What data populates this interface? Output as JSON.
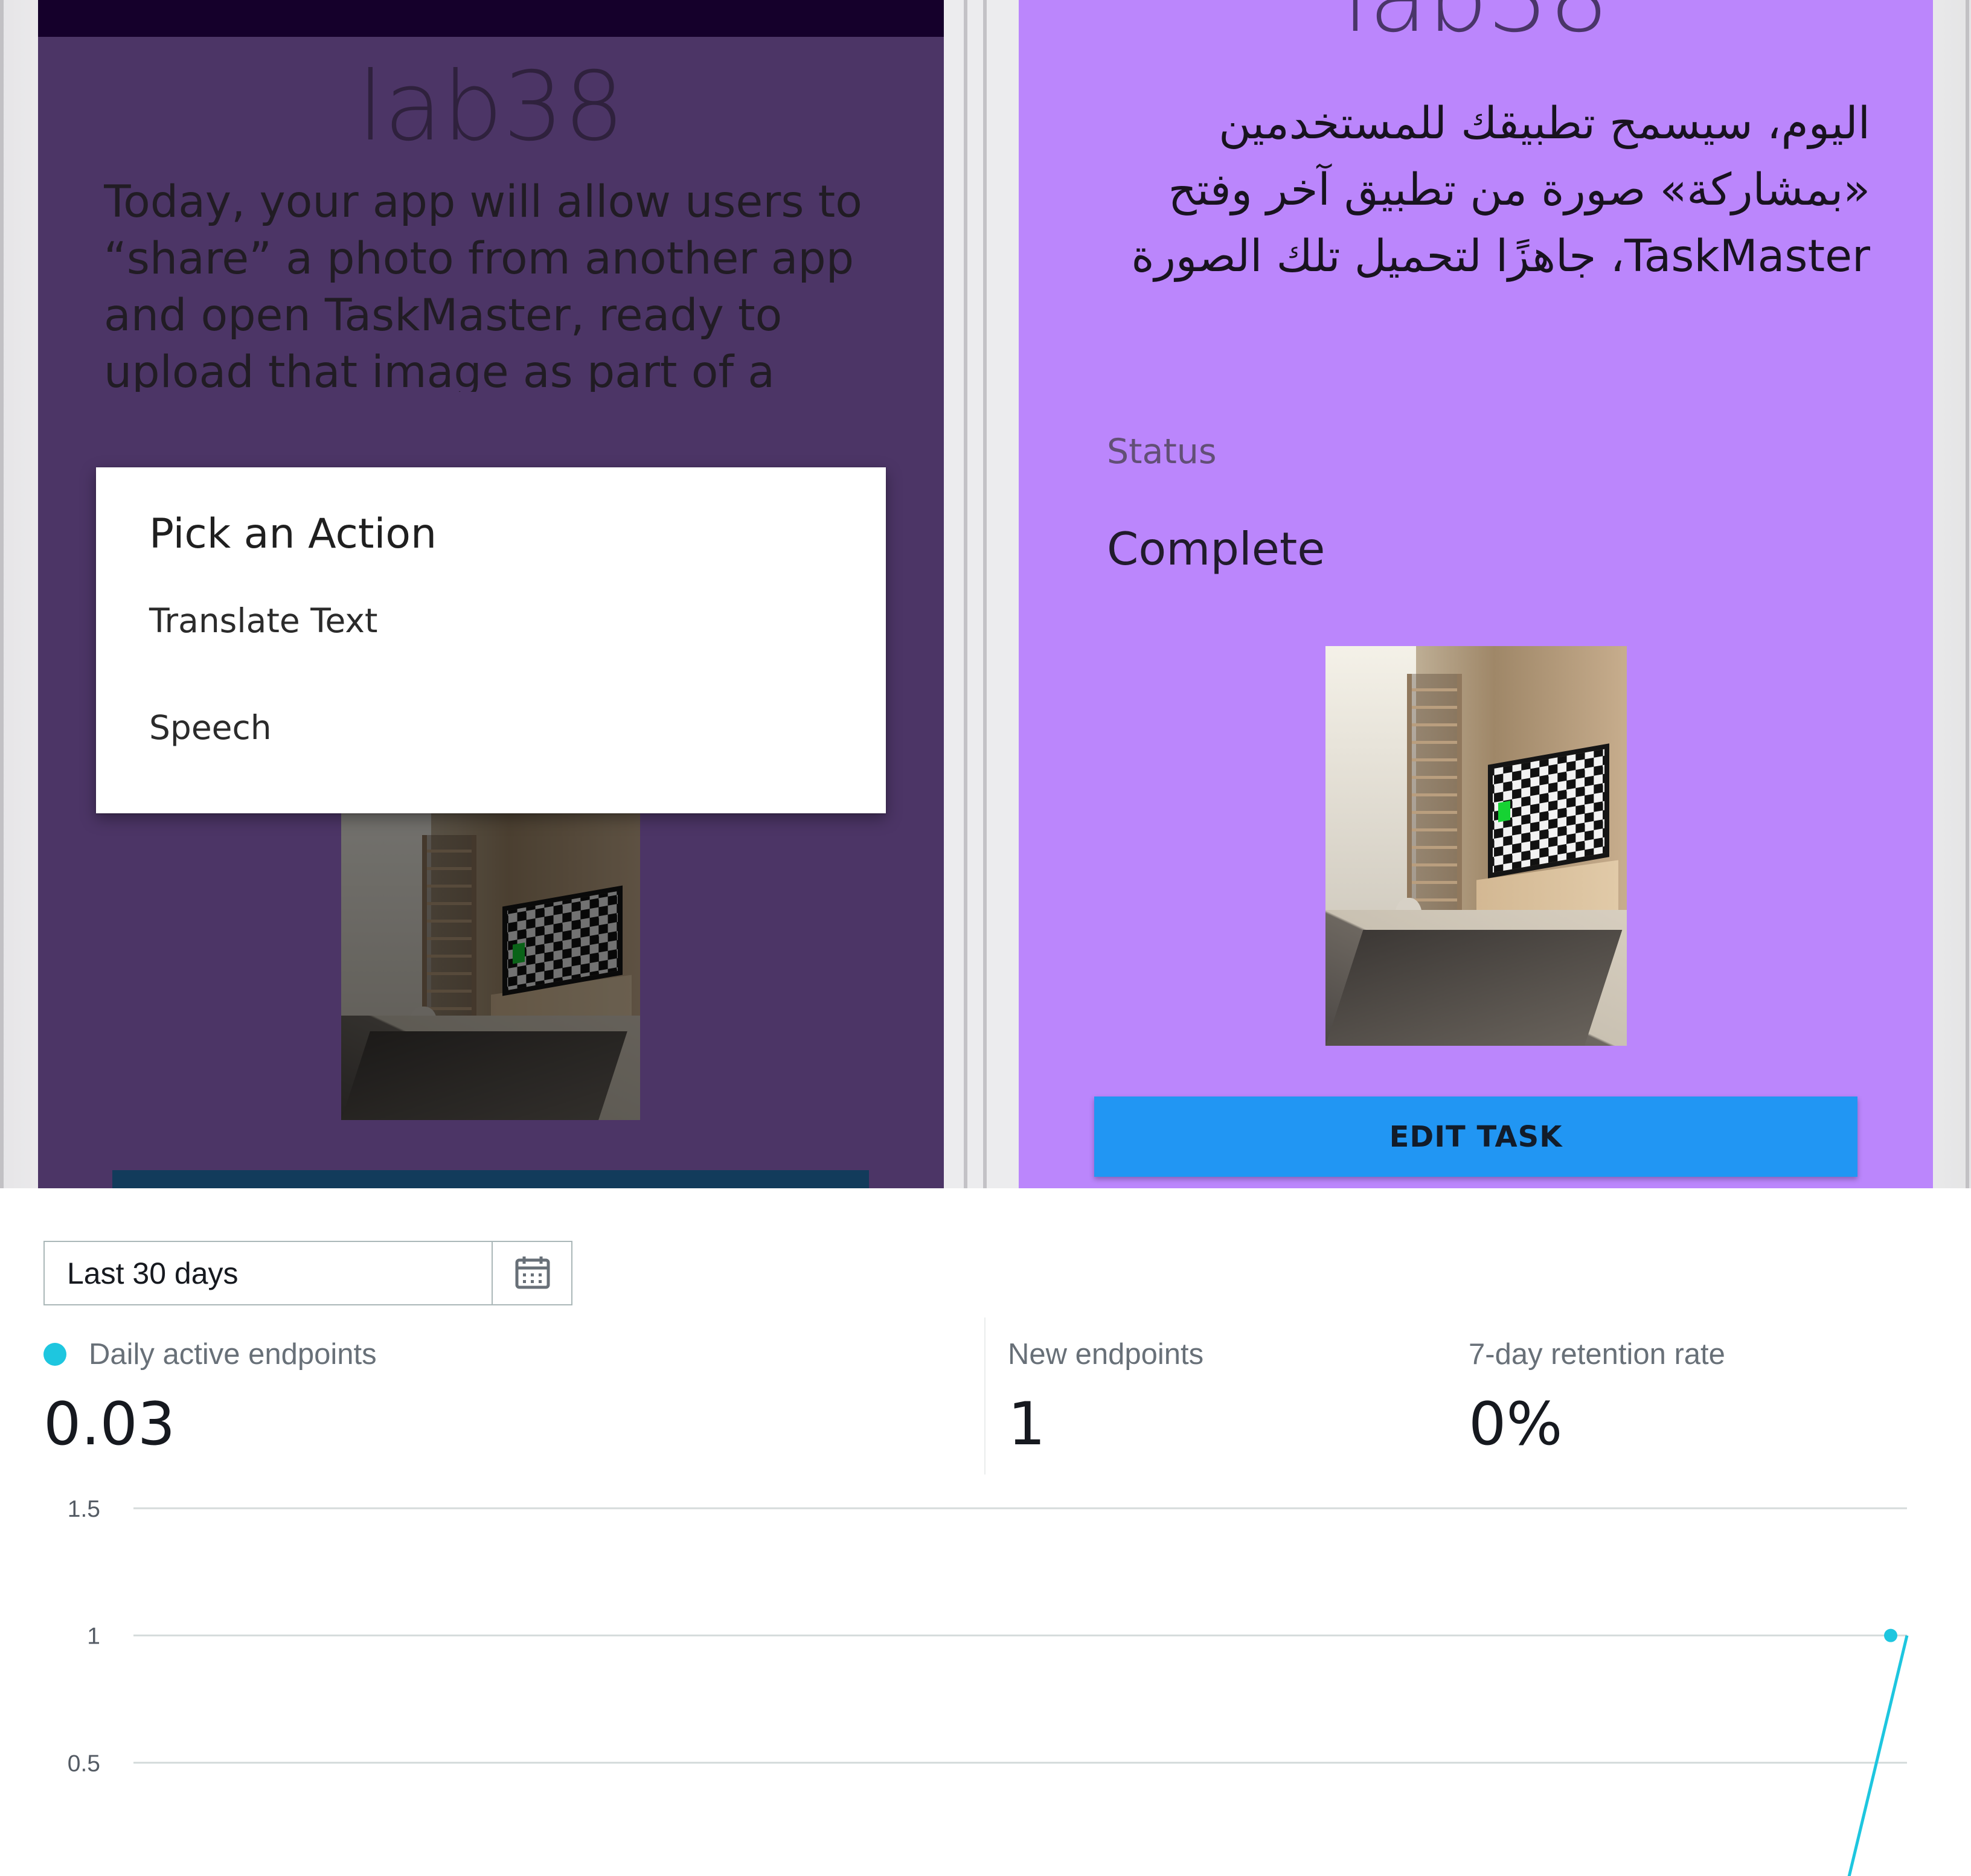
{
  "left_screen": {
    "title": "lab38",
    "description": "Today, your app will allow users to “share” a photo from another app and open TaskMaster, ready to upload that image as part of a new",
    "dialog": {
      "title": "Pick an Action",
      "items": [
        "Translate Text",
        "Speech"
      ]
    }
  },
  "right_screen": {
    "title": "lab38",
    "description": "اليوم، سيسمح تطبيقك للمستخدمين «بمشاركة» صورة من تطبيق آخر وفتح TaskMaster، جاهزًا لتحميل تلك الصورة",
    "status_label": "Status",
    "status_value": "Complete",
    "edit_button_label": "EDIT TASK"
  },
  "analytics": {
    "date_range": "Last 30 days",
    "metrics": [
      {
        "label": "Daily active endpoints",
        "value": "0.03"
      },
      {
        "label": "New endpoints",
        "value": "1"
      },
      {
        "label": "7-day retention rate",
        "value": "0%"
      }
    ],
    "colors": {
      "series": "#1ec6df",
      "gridline": "#d5dbdb"
    },
    "icons": {
      "date_picker": "calendar-icon"
    }
  },
  "chart_data": {
    "type": "line",
    "title": "",
    "xlabel": "",
    "ylabel": "",
    "y_ticks": [
      "1.5",
      "1",
      "0.5"
    ],
    "ylim": [
      0,
      1.5
    ],
    "grid": true,
    "series": [
      {
        "values": [
          0,
          0,
          0,
          0,
          0,
          0,
          0,
          0,
          0,
          0,
          0,
          0,
          0,
          0,
          0,
          0,
          0,
          0,
          0,
          0,
          0,
          0,
          0,
          0,
          0,
          0,
          0,
          0,
          0,
          1
        ]
      }
    ]
  }
}
